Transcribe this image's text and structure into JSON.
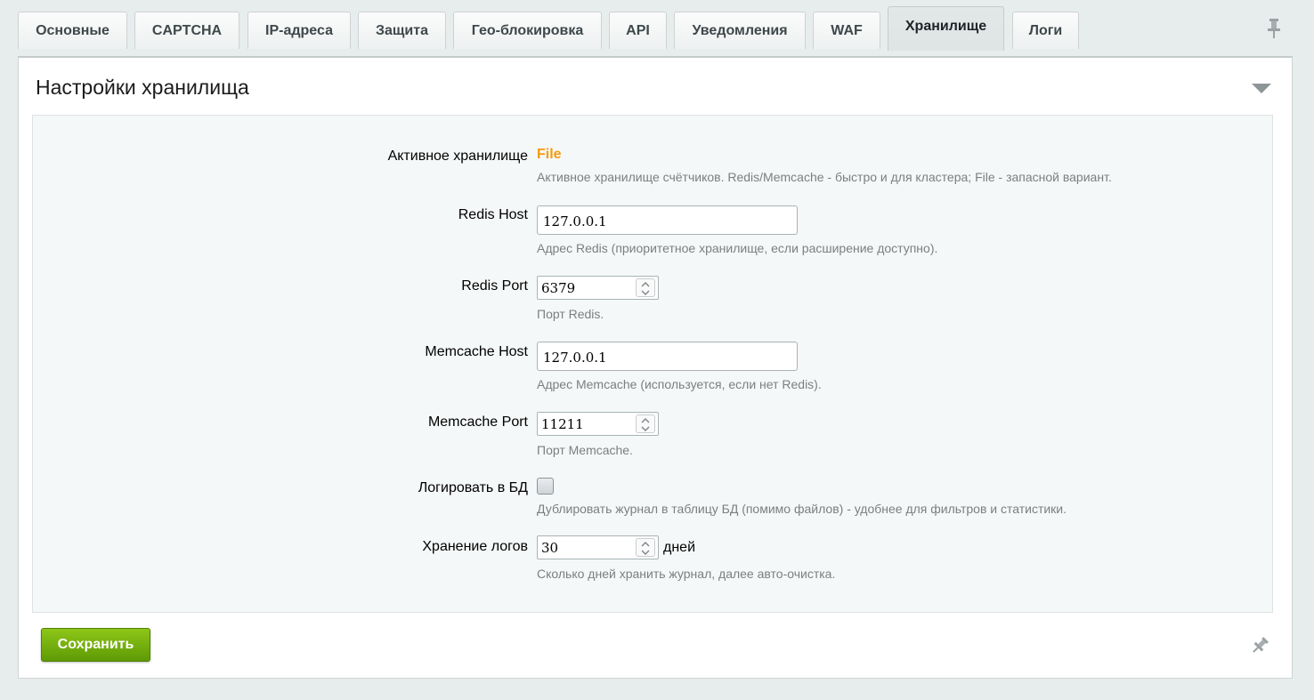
{
  "tabs": [
    {
      "label": "Основные"
    },
    {
      "label": "CAPTCHA"
    },
    {
      "label": "IP-адреса"
    },
    {
      "label": "Защита"
    },
    {
      "label": "Гео-блокировка"
    },
    {
      "label": "API"
    },
    {
      "label": "Уведомления"
    },
    {
      "label": "WAF"
    },
    {
      "label": "Хранилище"
    },
    {
      "label": "Логи"
    }
  ],
  "active_tab": "Хранилище",
  "panel": {
    "title": "Настройки хранилища"
  },
  "form": {
    "active_storage": {
      "label": "Активное хранилище",
      "value": "File",
      "hint": "Активное хранилище счётчиков. Redis/Memcache - быстро и для кластера; File - запасной вариант."
    },
    "redis_host": {
      "label": "Redis Host",
      "value": "127.0.0.1",
      "hint": "Адрес Redis (приоритетное хранилище, если расширение доступно)."
    },
    "redis_port": {
      "label": "Redis Port",
      "value": "6379",
      "hint": "Порт Redis."
    },
    "memcache_host": {
      "label": "Memcache Host",
      "value": "127.0.0.1",
      "hint": "Адрес Memcache (используется, если нет Redis)."
    },
    "memcache_port": {
      "label": "Memcache Port",
      "value": "11211",
      "hint": "Порт Memcache."
    },
    "log_to_db": {
      "label": "Логировать в БД",
      "checked": false,
      "hint": "Дублировать журнал в таблицу БД (помимо файлов) - удобнее для фильтров и статистики."
    },
    "log_retention": {
      "label": "Хранение логов",
      "value": "30",
      "suffix": "дней",
      "hint": "Сколько дней хранить журнал, далее авто-очистка."
    }
  },
  "actions": {
    "save_label": "Сохранить"
  },
  "colors": {
    "accent_orange": "#f59a10",
    "save_green": "#6fae0c"
  },
  "icons": {
    "pin": "pin-icon",
    "collapse": "chevron-down-icon"
  }
}
